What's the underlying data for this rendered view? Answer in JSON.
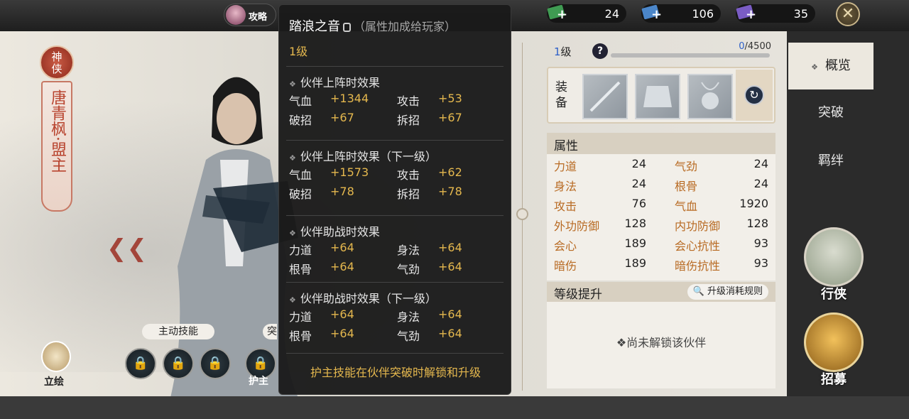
{
  "topbar": {
    "guide_label": "攻略",
    "resources": [
      {
        "icon": "green-ticket-icon",
        "color": "#3f9b52",
        "value": "24"
      },
      {
        "icon": "blue-ticket-icon",
        "color": "#4b86c9",
        "value": "106"
      },
      {
        "icon": "purple-ticket-icon",
        "color": "#7a5cc4",
        "value": "35"
      }
    ],
    "close_symbol": "✕"
  },
  "character": {
    "badge": "神侠",
    "name": "唐青枫·盟主"
  },
  "skills": {
    "active_label": "主动技能",
    "second_label": "突",
    "protect_label": "护主",
    "portrait_label": "立绘"
  },
  "tooltip": {
    "title": "踏浪之音",
    "subtitle": "（属性加成给玩家）",
    "level": "1级",
    "sections": [
      {
        "header": "伙伴上阵时效果",
        "rows": [
          [
            "气血",
            "+1344",
            "攻击",
            "+53"
          ],
          [
            "破招",
            "+67",
            "拆招",
            "+67"
          ]
        ]
      },
      {
        "header": "伙伴上阵时效果（下一级）",
        "rows": [
          [
            "气血",
            "+1573",
            "攻击",
            "+62"
          ],
          [
            "破招",
            "+78",
            "拆招",
            "+78"
          ]
        ]
      },
      {
        "header": "伙伴助战时效果",
        "rows": [
          [
            "力道",
            "+64",
            "身法",
            "+64"
          ],
          [
            "根骨",
            "+64",
            "气劲",
            "+64"
          ]
        ]
      },
      {
        "header": "伙伴助战时效果（下一级）",
        "rows": [
          [
            "力道",
            "+64",
            "身法",
            "+64"
          ],
          [
            "根骨",
            "+64",
            "气劲",
            "+64"
          ]
        ]
      }
    ],
    "footer": "护主技能在伙伴突破时解锁和升级"
  },
  "panel": {
    "level_num": "1",
    "level_unit": "级",
    "help": "?",
    "exp_current": "0",
    "exp_total": "/4500",
    "exp_fraction": 0,
    "equip_label": "装备",
    "equip_slots": [
      "sword-icon",
      "robe-icon",
      "pendant-icon"
    ],
    "attr_header": "属性",
    "attributes": [
      [
        "力道",
        "24",
        "气劲",
        "24"
      ],
      [
        "身法",
        "24",
        "根骨",
        "24"
      ],
      [
        "攻击",
        "76",
        "气血",
        "1920"
      ],
      [
        "外功防御",
        "128",
        "内功防御",
        "128"
      ],
      [
        "会心",
        "189",
        "会心抗性",
        "93"
      ],
      [
        "暗伤",
        "189",
        "暗伤抗性",
        "93"
      ]
    ],
    "upgrade_header": "等级提升",
    "rules_button": "升级消耗规则",
    "locked_text": "尚未解锁该伙伴"
  },
  "tabs": [
    "概览",
    "突破",
    "羁绊"
  ],
  "side_buttons": {
    "travel": "行侠",
    "recruit": "招募"
  }
}
